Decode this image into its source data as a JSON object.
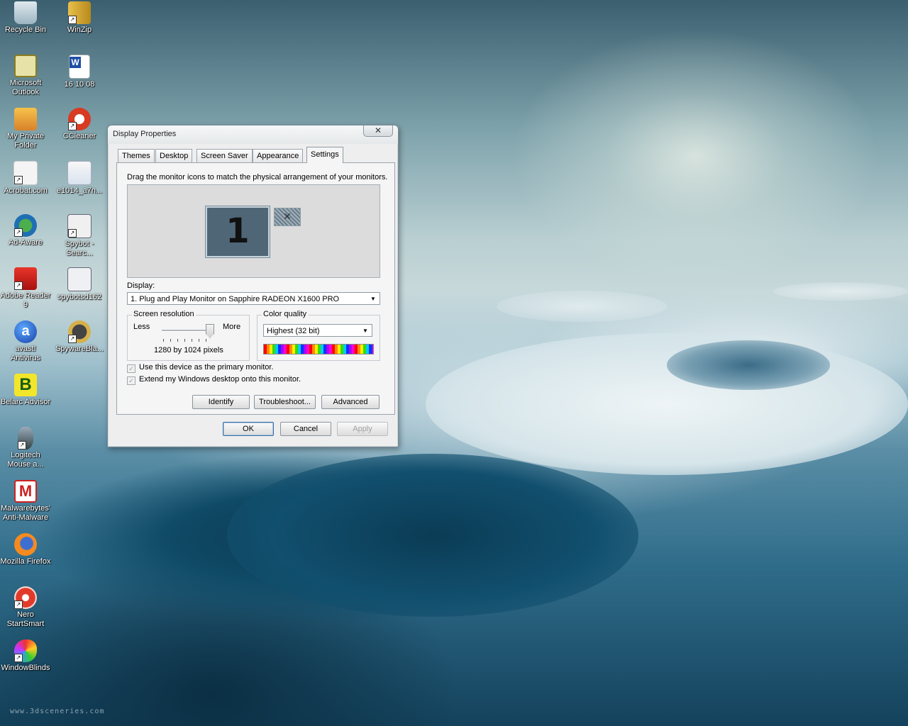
{
  "desktop": {
    "watermark": "www.3dsceneries.com",
    "icons": [
      {
        "label": "Recycle Bin",
        "icon": "recycle-bin-icon"
      },
      {
        "label": "WinZip",
        "icon": "winzip-icon"
      },
      {
        "label": "Microsoft Outlook",
        "icon": "outlook-icon"
      },
      {
        "label": "16 10 08",
        "icon": "word-document-icon"
      },
      {
        "label": "My Private Folder",
        "icon": "private-folder-icon"
      },
      {
        "label": "CCleaner",
        "icon": "ccleaner-icon"
      },
      {
        "label": "Acrobat.com",
        "icon": "acrobat-icon"
      },
      {
        "label": "e1014_a7n...",
        "icon": "archive-file-icon"
      },
      {
        "label": "Ad-Aware",
        "icon": "ad-aware-icon"
      },
      {
        "label": "Spybot - Searc...",
        "icon": "spybot-icon"
      },
      {
        "label": "Adobe Reader 9",
        "icon": "adobe-reader-icon"
      },
      {
        "label": "spybotsd162",
        "icon": "spybot-installer-icon"
      },
      {
        "label": "avast! Antivirus",
        "icon": "avast-icon"
      },
      {
        "label": "SpywareBla...",
        "icon": "spywareblaster-icon"
      },
      {
        "label": "Belarc Advisor",
        "icon": "belarc-icon"
      },
      {
        "label": "Logitech Mouse a...",
        "icon": "logitech-mouse-icon"
      },
      {
        "label": "Malwarebytes' Anti-Malware",
        "icon": "malwarebytes-icon"
      },
      {
        "label": "Mozilla Firefox",
        "icon": "firefox-icon"
      },
      {
        "label": "Nero StartSmart",
        "icon": "nero-icon"
      },
      {
        "label": "WindowBlinds",
        "icon": "windowblinds-icon"
      }
    ]
  },
  "dialog": {
    "title": "Display Properties",
    "close_label": "✕",
    "tabs": [
      {
        "label": "Themes"
      },
      {
        "label": "Desktop"
      },
      {
        "label": "Screen Saver"
      },
      {
        "label": "Appearance"
      },
      {
        "label": "Settings"
      }
    ],
    "active_tab": "Settings",
    "instruction": "Drag the monitor icons to match the physical arrangement of your monitors.",
    "monitor_primary_label": "1",
    "monitor_secondary_label": "✕",
    "display_label": "Display:",
    "display_value": "1. Plug and Play Monitor on Sapphire RADEON X1600 PRO",
    "resolution": {
      "title": "Screen resolution",
      "less": "Less",
      "more": "More",
      "value": "1280 by 1024 pixels",
      "slider_fraction": 1.0
    },
    "color_quality": {
      "title": "Color quality",
      "value": "Highest (32 bit)"
    },
    "checkboxes": [
      {
        "label": "Use this device as the primary monitor.",
        "checked": true,
        "enabled": false
      },
      {
        "label": "Extend my Windows desktop onto this monitor.",
        "checked": true,
        "enabled": false
      }
    ],
    "buttons": {
      "identify": "Identify",
      "troubleshoot": "Troubleshoot...",
      "advanced": "Advanced",
      "ok": "OK",
      "cancel": "Cancel",
      "apply": "Apply"
    }
  }
}
